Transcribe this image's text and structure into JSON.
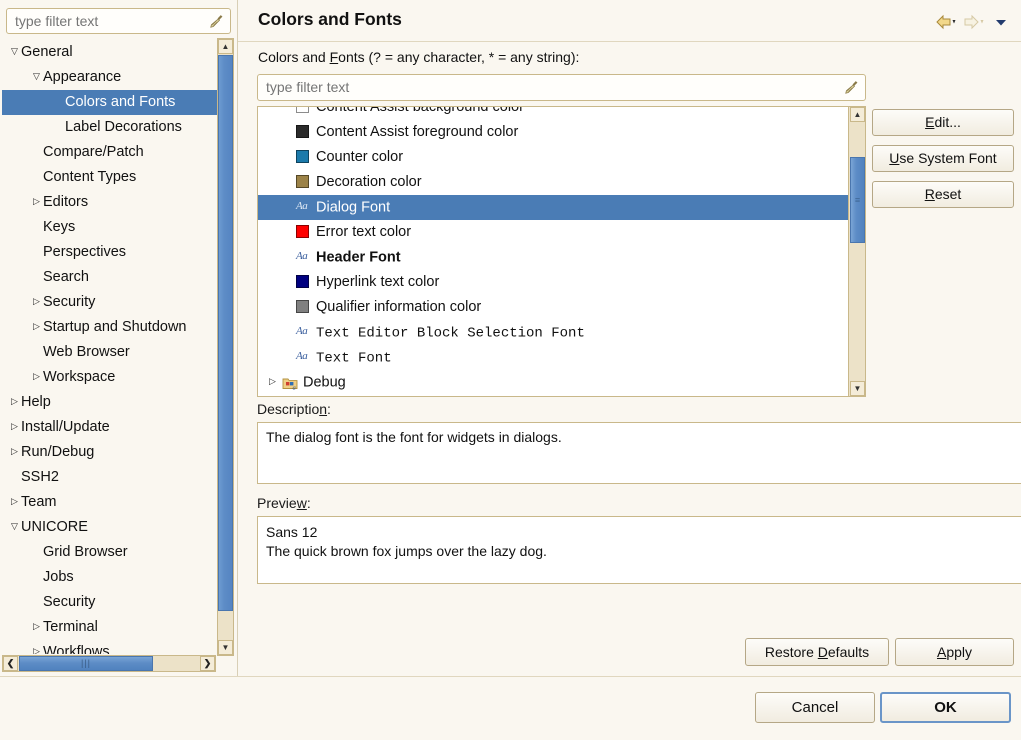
{
  "window": {
    "background": "#faf7f0",
    "selection_color": "#4a7cb5"
  },
  "sidebar": {
    "filter": {
      "placeholder": "type filter text",
      "value": "",
      "clear_icon": "broom-icon"
    },
    "items": [
      {
        "label": "General",
        "indent": 0,
        "twisty": "expanded",
        "selected": false
      },
      {
        "label": "Appearance",
        "indent": 1,
        "twisty": "expanded",
        "selected": false
      },
      {
        "label": "Colors and Fonts",
        "indent": 2,
        "twisty": "none",
        "selected": true
      },
      {
        "label": "Label Decorations",
        "indent": 2,
        "twisty": "none",
        "selected": false
      },
      {
        "label": "Compare/Patch",
        "indent": 1,
        "twisty": "none",
        "selected": false
      },
      {
        "label": "Content Types",
        "indent": 1,
        "twisty": "none",
        "selected": false
      },
      {
        "label": "Editors",
        "indent": 1,
        "twisty": "collapsed",
        "selected": false
      },
      {
        "label": "Keys",
        "indent": 1,
        "twisty": "none",
        "selected": false
      },
      {
        "label": "Perspectives",
        "indent": 1,
        "twisty": "none",
        "selected": false
      },
      {
        "label": "Search",
        "indent": 1,
        "twisty": "none",
        "selected": false
      },
      {
        "label": "Security",
        "indent": 1,
        "twisty": "collapsed",
        "selected": false
      },
      {
        "label": "Startup and Shutdown",
        "indent": 1,
        "twisty": "collapsed",
        "selected": false
      },
      {
        "label": "Web Browser",
        "indent": 1,
        "twisty": "none",
        "selected": false
      },
      {
        "label": "Workspace",
        "indent": 1,
        "twisty": "collapsed",
        "selected": false
      },
      {
        "label": "Help",
        "indent": 0,
        "twisty": "collapsed",
        "selected": false
      },
      {
        "label": "Install/Update",
        "indent": 0,
        "twisty": "collapsed",
        "selected": false
      },
      {
        "label": "Run/Debug",
        "indent": 0,
        "twisty": "collapsed",
        "selected": false
      },
      {
        "label": "SSH2",
        "indent": 0,
        "twisty": "none",
        "selected": false
      },
      {
        "label": "Team",
        "indent": 0,
        "twisty": "collapsed",
        "selected": false
      },
      {
        "label": "UNICORE",
        "indent": 0,
        "twisty": "expanded",
        "selected": false
      },
      {
        "label": "Grid Browser",
        "indent": 1,
        "twisty": "none",
        "selected": false
      },
      {
        "label": "Jobs",
        "indent": 1,
        "twisty": "none",
        "selected": false
      },
      {
        "label": "Security",
        "indent": 1,
        "twisty": "none",
        "selected": false
      },
      {
        "label": "Terminal",
        "indent": 1,
        "twisty": "collapsed",
        "selected": false
      },
      {
        "label": "Workflows",
        "indent": 1,
        "twisty": "collapsed",
        "selected": false
      }
    ]
  },
  "header": {
    "title": "Colors and Fonts",
    "back_icon": "back-arrow-icon",
    "forward_icon": "forward-arrow-icon",
    "menu_icon": "chevron-down-icon"
  },
  "main": {
    "filter_label": "Colors and Fonts (? = any character, * = any string):",
    "filter_label_mnemonic": "F",
    "filter": {
      "placeholder": "type filter text",
      "value": "",
      "clear_icon": "broom-icon"
    },
    "list": [
      {
        "label": "Content Assist background color",
        "kind": "color",
        "color": "#ffffff",
        "selected": false,
        "clipped": true
      },
      {
        "label": "Content Assist foreground color",
        "kind": "color",
        "color": "#2b2b2b",
        "selected": false
      },
      {
        "label": "Counter color",
        "kind": "color",
        "color": "#1b7aab",
        "selected": false
      },
      {
        "label": "Decoration color",
        "kind": "color",
        "color": "#9c8348",
        "selected": false
      },
      {
        "label": "Dialog Font",
        "kind": "font",
        "selected": true,
        "style": "normal"
      },
      {
        "label": "Error text color",
        "kind": "color",
        "color": "#fe0000",
        "selected": false
      },
      {
        "label": "Header Font",
        "kind": "font",
        "selected": false,
        "style": "bold"
      },
      {
        "label": "Hyperlink text color",
        "kind": "color",
        "color": "#000080",
        "selected": false
      },
      {
        "label": "Qualifier information color",
        "kind": "color",
        "color": "#808080",
        "selected": false
      },
      {
        "label": "Text Editor Block Selection Font",
        "kind": "font",
        "selected": false,
        "style": "mono"
      },
      {
        "label": "Text Font",
        "kind": "font",
        "selected": false,
        "style": "mono"
      },
      {
        "label": "Debug",
        "kind": "folder",
        "selected": false,
        "twisty": "collapsed"
      }
    ],
    "buttons": {
      "edit": {
        "label": "Edit...",
        "mnemonic": "E"
      },
      "use_system": {
        "label": "Use System Font",
        "mnemonic": "U"
      },
      "reset": {
        "label": "Reset",
        "mnemonic": "R"
      }
    },
    "description": {
      "label": "Description:",
      "label_mnemonic": "n",
      "text": "The dialog font is the font for widgets in dialogs."
    },
    "preview": {
      "label": "Preview:",
      "label_mnemonic": "w",
      "line1": "Sans 12",
      "line2": "The quick brown fox jumps over the lazy dog."
    }
  },
  "actions": {
    "restore_defaults": {
      "label": "Restore Defaults",
      "mnemonic": "D"
    },
    "apply": {
      "label": "Apply",
      "mnemonic": "A"
    },
    "cancel": {
      "label": "Cancel"
    },
    "ok": {
      "label": "OK",
      "focused": true
    }
  }
}
